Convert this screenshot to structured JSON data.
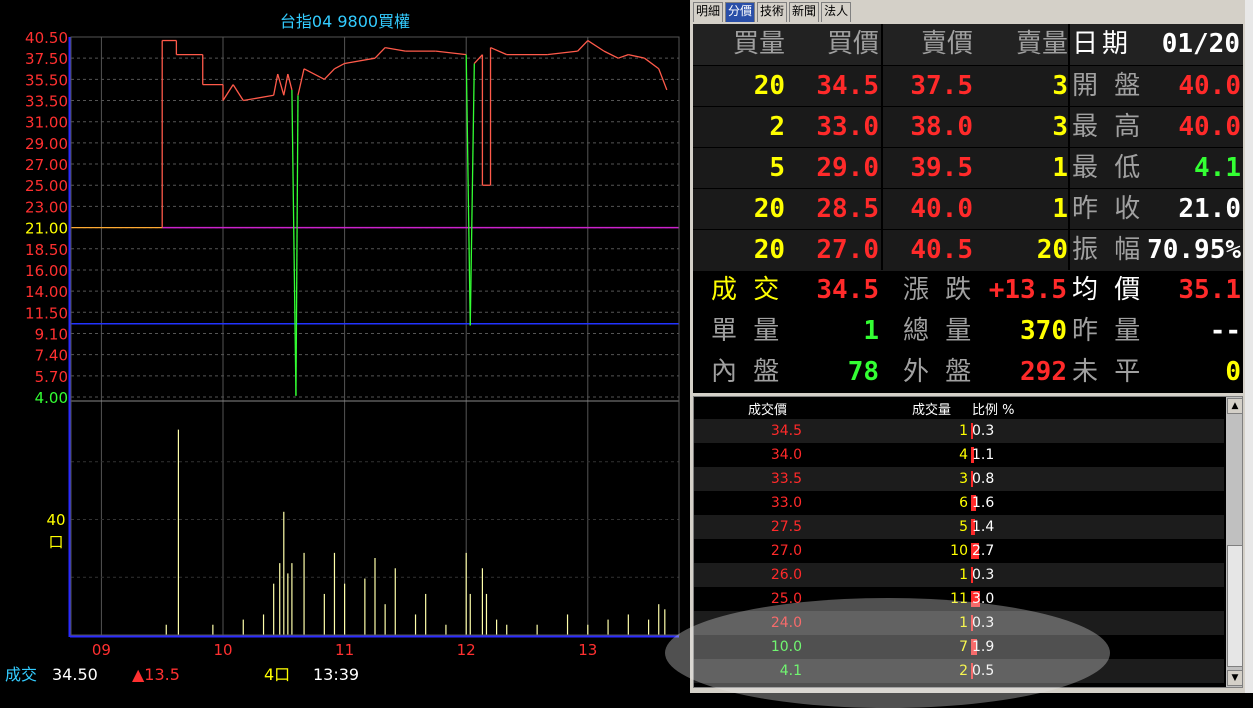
{
  "chart": {
    "title": "台指04 9800買權",
    "ytick_labels": [
      "40.50",
      "37.50",
      "35.50",
      "33.50",
      "31.00",
      "29.00",
      "27.00",
      "25.00",
      "23.00",
      "21.00",
      "18.50",
      "16.00",
      "14.00",
      "11.50",
      "9.10",
      "7.40",
      "5.70",
      "4.00"
    ],
    "ytick_values": [
      40.5,
      37.5,
      35.5,
      33.5,
      31.0,
      29.0,
      27.0,
      25.0,
      23.0,
      21.0,
      18.5,
      16.0,
      14.0,
      11.5,
      9.1,
      7.4,
      5.7,
      4.0
    ],
    "xtick_labels": [
      "09",
      "10",
      "11",
      "12",
      "13"
    ],
    "volume_label_value": "40",
    "volume_label_unit": "口",
    "footer": {
      "trade_label": "成交",
      "trade_price": "34.50",
      "change": "▲13.5",
      "volume": "4口",
      "time": "13:39"
    }
  },
  "chart_data": {
    "type": "line",
    "title": "台指04 9800買權",
    "x_range": [
      "08:45",
      "13:45"
    ],
    "reference_price": 21.0,
    "ylim": [
      4.0,
      40.5
    ],
    "xtick_labels": [
      "09",
      "10",
      "11",
      "12",
      "13"
    ],
    "series": [
      {
        "values": [
          [
            "08:45",
            21.0
          ],
          [
            "09:30",
            21.0
          ],
          [
            "09:30",
            40.0
          ],
          [
            "09:37",
            40.0
          ],
          [
            "09:37",
            38.0
          ],
          [
            "09:50",
            38.0
          ],
          [
            "09:50",
            35.0
          ],
          [
            "10:00",
            35.0
          ],
          [
            "10:00",
            33.5
          ],
          [
            "10:05",
            35.0
          ],
          [
            "10:10",
            33.5
          ],
          [
            "10:25",
            34.0
          ],
          [
            "10:27",
            36.0
          ],
          [
            "10:30",
            34.0
          ],
          [
            "10:32",
            36.0
          ],
          [
            "10:34",
            34.5
          ],
          [
            "10:36",
            4.1
          ],
          [
            "10:37",
            34.0
          ],
          [
            "10:40",
            36.5
          ],
          [
            "10:50",
            35.5
          ],
          [
            "10:55",
            36.5
          ],
          [
            "11:00",
            37.0
          ],
          [
            "11:15",
            37.5
          ],
          [
            "11:20",
            39.0
          ],
          [
            "11:30",
            38.5
          ],
          [
            "11:45",
            38.5
          ],
          [
            "12:00",
            38.0
          ],
          [
            "12:02",
            10.0
          ],
          [
            "12:04",
            37.0
          ],
          [
            "12:08",
            38.0
          ],
          [
            "12:08",
            25.0
          ],
          [
            "12:12",
            25.0
          ],
          [
            "12:12",
            39.0
          ],
          [
            "12:20",
            38.0
          ],
          [
            "12:40",
            38.0
          ],
          [
            "12:55",
            38.5
          ],
          [
            "13:00",
            40.0
          ],
          [
            "13:08",
            38.5
          ],
          [
            "13:15",
            37.5
          ],
          [
            "13:20",
            38.0
          ],
          [
            "13:28",
            37.5
          ],
          [
            "13:35",
            36.5
          ],
          [
            "13:39",
            34.5
          ]
        ]
      }
    ],
    "volume_axis_label": "40",
    "volume_bars": [
      [
        "09:32",
        2
      ],
      [
        "09:38",
        40
      ],
      [
        "09:55",
        2
      ],
      [
        "10:10",
        3
      ],
      [
        "10:20",
        4
      ],
      [
        "10:25",
        10
      ],
      [
        "10:28",
        14
      ],
      [
        "10:30",
        24
      ],
      [
        "10:32",
        12
      ],
      [
        "10:34",
        14
      ],
      [
        "10:40",
        16
      ],
      [
        "10:50",
        8
      ],
      [
        "10:55",
        16
      ],
      [
        "11:00",
        10
      ],
      [
        "11:10",
        11
      ],
      [
        "11:15",
        15
      ],
      [
        "11:20",
        6
      ],
      [
        "11:25",
        13
      ],
      [
        "11:35",
        4
      ],
      [
        "11:40",
        8
      ],
      [
        "11:50",
        2
      ],
      [
        "12:00",
        16
      ],
      [
        "12:02",
        8
      ],
      [
        "12:08",
        13
      ],
      [
        "12:10",
        8
      ],
      [
        "12:15",
        3
      ],
      [
        "12:20",
        2
      ],
      [
        "12:35",
        2
      ],
      [
        "12:50",
        4
      ],
      [
        "13:00",
        2
      ],
      [
        "13:10",
        3
      ],
      [
        "13:20",
        4
      ],
      [
        "13:30",
        3
      ],
      [
        "13:35",
        6
      ],
      [
        "13:38",
        5
      ]
    ]
  },
  "tabs": [
    {
      "label": "明細",
      "active": false
    },
    {
      "label": "分價",
      "active": true
    },
    {
      "label": "技術",
      "active": false
    },
    {
      "label": "新聞",
      "active": false
    },
    {
      "label": "法人",
      "active": false
    }
  ],
  "quote": {
    "headers": {
      "bid_qty": "買量",
      "bid": "買價",
      "ask": "賣價",
      "ask_qty": "賣量"
    },
    "date_label": "日期",
    "date_value": "01/20",
    "book": [
      {
        "bid_qty": "20",
        "bid": "34.5",
        "ask": "37.5",
        "ask_qty": "3",
        "stat_label": "開 盤",
        "stat_value": "40.0",
        "stat_color": "#ff2a2a"
      },
      {
        "bid_qty": "2",
        "bid": "33.0",
        "ask": "38.0",
        "ask_qty": "3",
        "stat_label": "最 高",
        "stat_value": "40.0",
        "stat_color": "#ff2a2a"
      },
      {
        "bid_qty": "5",
        "bid": "29.0",
        "ask": "39.5",
        "ask_qty": "1",
        "stat_label": "最 低",
        "stat_value": "4.1",
        "stat_color": "#33ff33"
      },
      {
        "bid_qty": "20",
        "bid": "28.5",
        "ask": "40.0",
        "ask_qty": "1",
        "stat_label": "昨 收",
        "stat_value": "21.0",
        "stat_color": "#ffffff"
      },
      {
        "bid_qty": "20",
        "bid": "27.0",
        "ask": "40.5",
        "ask_qty": "20",
        "stat_label": "振 幅",
        "stat_value": "70.95%",
        "stat_color": "#ffffff"
      }
    ],
    "summary": [
      [
        {
          "label": "成 交",
          "value": "34.5",
          "label_color": "#ffff00",
          "value_color": "#ff2a2a"
        },
        {
          "label": "漲 跌",
          "value": "+13.5",
          "label_color": "#a0a0a0",
          "value_color": "#ff2a2a"
        },
        {
          "label": "均 價",
          "value": "35.1",
          "label_color": "#ffffff",
          "value_color": "#ff2a2a"
        }
      ],
      [
        {
          "label": "單 量",
          "value": "1",
          "label_color": "#a0a0a0",
          "value_color": "#33ff33"
        },
        {
          "label": "總 量",
          "value": "370",
          "label_color": "#a0a0a0",
          "value_color": "#ffff00"
        },
        {
          "label": "昨 量",
          "value": "--",
          "label_color": "#a0a0a0",
          "value_color": "#ffffff"
        }
      ],
      [
        {
          "label": "內 盤",
          "value": "78",
          "label_color": "#a0a0a0",
          "value_color": "#33ff33"
        },
        {
          "label": "外 盤",
          "value": "292",
          "label_color": "#a0a0a0",
          "value_color": "#ff2a2a"
        },
        {
          "label": "未 平",
          "value": "0",
          "label_color": "#a0a0a0",
          "value_color": "#ffff00"
        }
      ]
    ]
  },
  "distribution": {
    "headers": {
      "price": "成交價",
      "volume": "成交量",
      "ratio": "比例 %"
    },
    "rows": [
      {
        "price": "34.5",
        "volume": "1",
        "ratio": "0.3",
        "color": "#ff2a2a"
      },
      {
        "price": "34.0",
        "volume": "4",
        "ratio": "1.1",
        "color": "#ff2a2a"
      },
      {
        "price": "33.5",
        "volume": "3",
        "ratio": "0.8",
        "color": "#ff2a2a"
      },
      {
        "price": "33.0",
        "volume": "6",
        "ratio": "1.6",
        "color": "#ff2a2a"
      },
      {
        "price": "27.5",
        "volume": "5",
        "ratio": "1.4",
        "color": "#ff2a2a"
      },
      {
        "price": "27.0",
        "volume": "10",
        "ratio": "2.7",
        "color": "#ff2a2a"
      },
      {
        "price": "26.0",
        "volume": "1",
        "ratio": "0.3",
        "color": "#ff2a2a"
      },
      {
        "price": "25.0",
        "volume": "11",
        "ratio": "3.0",
        "color": "#ff2a2a"
      },
      {
        "price": "24.0",
        "volume": "1",
        "ratio": "0.3",
        "color": "#ff2a2a"
      },
      {
        "price": "10.0",
        "volume": "7",
        "ratio": "1.9",
        "color": "#33ff33"
      },
      {
        "price": "4.1",
        "volume": "2",
        "ratio": "0.5",
        "color": "#33ff33"
      }
    ]
  },
  "colors": {
    "price_line": "#ff5a4a",
    "reference_line": "#cc22cc",
    "low_line": "#2233ff",
    "drop_spike": "#33ff33",
    "volume_bar": "#ffffaa",
    "axis": "#2a2aff"
  }
}
